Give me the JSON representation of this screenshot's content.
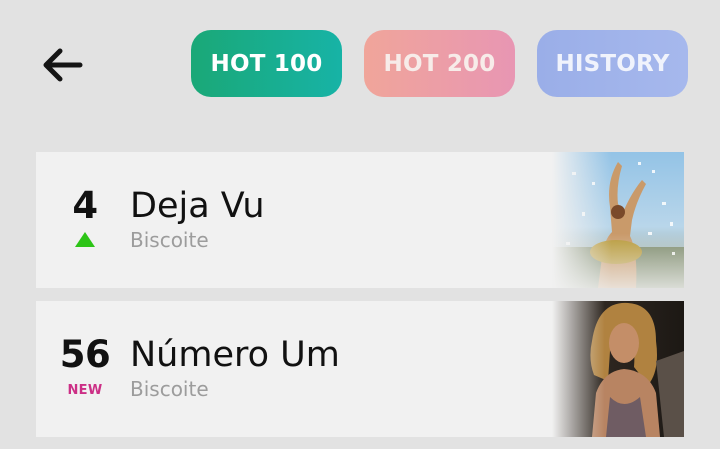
{
  "header": {
    "back_icon": "arrow-left-icon",
    "tabs": [
      {
        "label": "HOT 100",
        "active": true,
        "color": "#17b3a6"
      },
      {
        "label": "HOT 200",
        "active": false,
        "color": "#eca0a6"
      },
      {
        "label": "HISTORY",
        "active": false,
        "color": "#a0b3ea"
      }
    ]
  },
  "chart": {
    "entries": [
      {
        "rank": "4",
        "title": "Deja Vu",
        "artist": "Biscoite",
        "movement": "up",
        "trend_color": "#2dc417"
      },
      {
        "rank": "56",
        "title": "Número Um",
        "artist": "Biscoite",
        "badge": "NEW",
        "badge_color": "#cc2f86"
      }
    ]
  }
}
